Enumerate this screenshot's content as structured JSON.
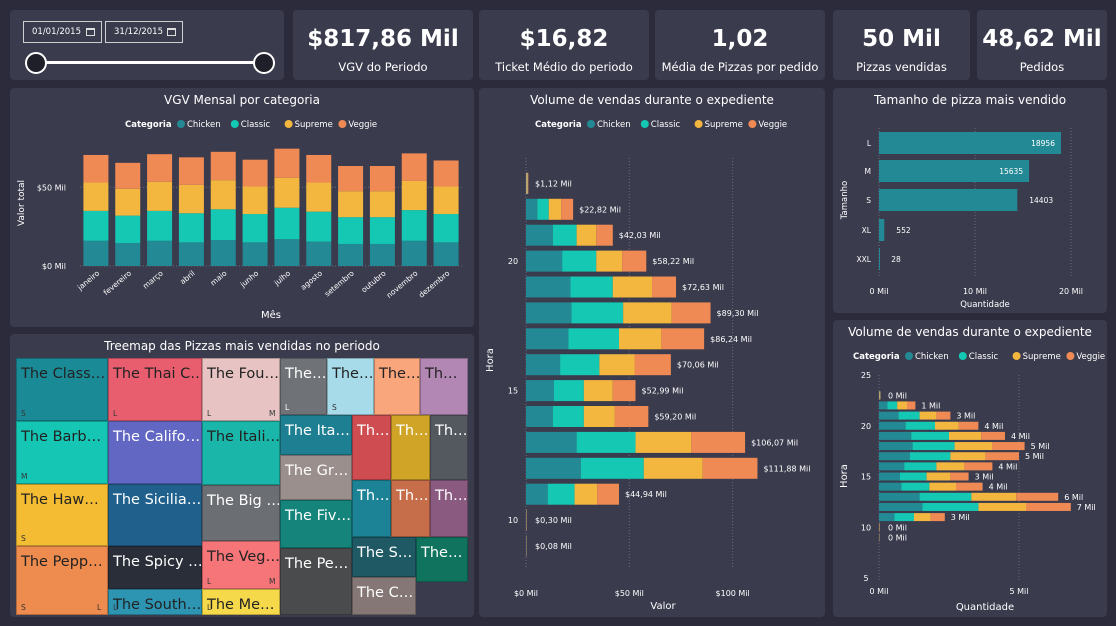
{
  "colors": {
    "chicken": "#238a95",
    "classic": "#14c8b4",
    "supreme": "#f3b63f",
    "veggie": "#ef8a55",
    "bg": "#2b2b3b",
    "panel": "#3a3b4d",
    "size_bar": "#238a95"
  },
  "filter": {
    "start_date": "01/01/2015",
    "end_date": "31/12/2015"
  },
  "kpis": [
    {
      "value": "$817,86 Mil",
      "label": "VGV do Periodo"
    },
    {
      "value": "$16,82",
      "label": "Ticket Médio do periodo"
    },
    {
      "value": "1,02",
      "label": "Média de Pizzas por pedido"
    },
    {
      "value": "50 Mil",
      "label": "Pizzas vendidas"
    },
    {
      "value": "48,62 Mil",
      "label": "Pedidos"
    }
  ],
  "legend": {
    "title": "Categoria",
    "items": [
      "Chicken",
      "Classic",
      "Supreme",
      "Veggie"
    ]
  },
  "chart_data": [
    {
      "type": "bar",
      "stacked": true,
      "title": "VGV Mensal por categoria",
      "xlabel": "Mês",
      "ylabel": "Valor total",
      "categories": [
        "janeiro",
        "fevereiro",
        "março",
        "abril",
        "maio",
        "junho",
        "julho",
        "agosto",
        "setembro",
        "outubro",
        "novembro",
        "dezembro"
      ],
      "series": [
        {
          "name": "Chicken",
          "values": [
            16,
            14.5,
            16,
            15,
            16.5,
            15,
            17,
            15.5,
            14,
            14,
            16,
            15
          ]
        },
        {
          "name": "Classic",
          "values": [
            19,
            17.5,
            19,
            18.5,
            19.5,
            18,
            20,
            19,
            17,
            17,
            19.5,
            18
          ]
        },
        {
          "name": "Supreme",
          "values": [
            18,
            17,
            18.5,
            18,
            18.5,
            17.5,
            19,
            18.5,
            16.5,
            16.5,
            18.5,
            17.5
          ]
        },
        {
          "name": "Veggie",
          "values": [
            17.5,
            16.5,
            17.5,
            17.5,
            18,
            17,
            18.5,
            17.5,
            16,
            16,
            17.5,
            16.5
          ]
        }
      ],
      "yticks": [
        "$0 Mil",
        "$50 Mil"
      ],
      "ylim": [
        0,
        80
      ]
    },
    {
      "type": "bar",
      "orientation": "horizontal",
      "stacked": true,
      "title": "Volume de vendas durante o expediente",
      "xlabel": "Valor",
      "ylabel": "Hora",
      "categories": [
        9,
        10,
        11,
        12,
        13,
        14,
        15,
        16,
        17,
        18,
        19,
        20,
        21,
        22,
        23
      ],
      "series": [
        {
          "name": "Chicken",
          "values": [
            0.02,
            0.07,
            10.5,
            26.5,
            24.5,
            13.0,
            13.5,
            16.5,
            20.5,
            22.0,
            21.5,
            17.5,
            13.0,
            5.5,
            0.3
          ]
        },
        {
          "name": "Classic",
          "values": [
            0.02,
            0.08,
            13.0,
            30.5,
            28.5,
            15.0,
            14.5,
            19.0,
            24.5,
            25.0,
            20.5,
            16.5,
            11.5,
            5.5,
            0.3
          ]
        },
        {
          "name": "Supreme",
          "values": [
            0.02,
            0.08,
            11.0,
            28.5,
            27.0,
            15.0,
            14.0,
            17.0,
            20.5,
            23.5,
            19.0,
            12.5,
            9.5,
            6.0,
            0.3
          ]
        },
        {
          "name": "Veggie",
          "values": [
            0.02,
            0.07,
            10.5,
            26.5,
            26.0,
            16.2,
            11.0,
            17.6,
            20.7,
            18.8,
            11.6,
            11.7,
            8.0,
            5.8,
            0.22
          ]
        }
      ],
      "data_labels": [
        "$0,08 Mil",
        "$0,30 Mil",
        "$44,94 Mil",
        "$111,88 Mil",
        "$106,07 Mil",
        "$59,20 Mil",
        "$52,99 Mil",
        "$70,06 Mil",
        "$86,24 Mil",
        "$89,30 Mil",
        "$72,63 Mil",
        "$58,22 Mil",
        "$42,03 Mil",
        "$22,82 Mil",
        "$1,12 Mil"
      ],
      "xticks": [
        "$0 Mil",
        "$50 Mil",
        "$100 Mil"
      ],
      "yticks": [
        "10",
        "15",
        "20"
      ],
      "xlim": [
        0,
        120
      ]
    },
    {
      "type": "bar",
      "orientation": "horizontal",
      "title": "Tamanho de pizza mais vendido",
      "xlabel": "Quantidade",
      "ylabel": "Tamanho",
      "categories": [
        "L",
        "M",
        "S",
        "XL",
        "XXL"
      ],
      "values": [
        18956,
        15635,
        14403,
        552,
        28
      ],
      "xticks": [
        "0 Mil",
        "10 Mil",
        "20 Mil"
      ],
      "xlim": [
        0,
        20000
      ]
    },
    {
      "type": "bar",
      "orientation": "horizontal",
      "stacked": true,
      "title": "Volume de vendas durante o expediente",
      "xlabel": "Quantidade",
      "ylabel": "Hora",
      "categories": [
        9,
        10,
        11,
        12,
        13,
        14,
        15,
        16,
        17,
        18,
        19,
        20,
        21,
        22,
        23
      ],
      "series": [
        {
          "name": "Chicken",
          "values": [
            0.002,
            0.006,
            0.55,
            1.55,
            1.45,
            0.8,
            0.75,
            0.9,
            1.1,
            1.2,
            1.15,
            0.95,
            0.7,
            0.3,
            0.01
          ]
        },
        {
          "name": "Classic",
          "values": [
            0.002,
            0.007,
            0.7,
            2.0,
            1.85,
            1.0,
            0.95,
            1.15,
            1.45,
            1.5,
            1.35,
            1.05,
            0.75,
            0.35,
            0.012
          ]
        },
        {
          "name": "Supreme",
          "values": [
            0.002,
            0.006,
            0.6,
            1.7,
            1.6,
            0.95,
            0.85,
            1.0,
            1.25,
            1.35,
            1.15,
            0.85,
            0.6,
            0.35,
            0.01
          ]
        },
        {
          "name": "Veggie",
          "values": [
            0.002,
            0.005,
            0.5,
            1.6,
            1.5,
            0.95,
            0.65,
            1.0,
            1.2,
            1.15,
            0.85,
            0.7,
            0.5,
            0.3,
            0.008
          ]
        }
      ],
      "data_labels": [
        "0 Mil",
        "0 Mil",
        "3 Mil",
        "7 Mil",
        "6 Mil",
        "4 Mil",
        "3 Mil",
        "4 Mil",
        "5 Mil",
        "5 Mil",
        "4 Mil",
        "4 Mil",
        "3 Mil",
        "1 Mil",
        "0 Mil"
      ],
      "xticks": [
        "0 Mil",
        "5 Mil"
      ],
      "yticks": [
        "5",
        "10",
        "15",
        "20",
        "25"
      ],
      "ylim": [
        5,
        25
      ],
      "xlim": [
        0,
        8
      ]
    },
    {
      "type": "treemap",
      "title": "Treemap das Pizzas mais vendidas no periodo",
      "cells": [
        {
          "name": "The Class…",
          "color": "#1b8a97",
          "sizes": [
            "S"
          ]
        },
        {
          "name": "The Thai C…",
          "color": "#e85e6f",
          "sizes": [
            "L"
          ]
        },
        {
          "name": "The Fou…",
          "color": "#e7c4c3",
          "sizes": [
            "L",
            "M"
          ]
        },
        {
          "name": "The…",
          "color": "#6f7378",
          "sizes": [
            "L"
          ]
        },
        {
          "name": "The…",
          "color": "#a7dbea",
          "sizes": [
            "S"
          ]
        },
        {
          "name": "The…",
          "color": "#f9a67d",
          "sizes": []
        },
        {
          "name": "Th…",
          "color": "#b287b3",
          "sizes": []
        },
        {
          "name": "The Barb…",
          "color": "#16c6b5",
          "sizes": [
            "M"
          ]
        },
        {
          "name": "The Califo…",
          "color": "#6367c4",
          "sizes": []
        },
        {
          "name": "The Itali…",
          "color": "#19b6a9",
          "sizes": []
        },
        {
          "name": "The Ita…",
          "color": "#1e7f92",
          "sizes": []
        },
        {
          "name": "Th…",
          "color": "#cf4d51",
          "sizes": []
        },
        {
          "name": "Th…",
          "color": "#cfa427",
          "sizes": []
        },
        {
          "name": "Th…",
          "color": "#545960",
          "sizes": []
        },
        {
          "name": "The Haw…",
          "color": "#f3bc32",
          "sizes": [
            "S"
          ]
        },
        {
          "name": "The Sicilia…",
          "color": "#1f608c",
          "sizes": []
        },
        {
          "name": "The Big …",
          "color": "#6b6e73",
          "sizes": []
        },
        {
          "name": "The Gr…",
          "color": "#9a8f8c",
          "sizes": []
        },
        {
          "name": "Th…",
          "color": "#1c8396",
          "sizes": []
        },
        {
          "name": "Th…",
          "color": "#c66d49",
          "sizes": []
        },
        {
          "name": "Th…",
          "color": "#8b5a80",
          "sizes": []
        },
        {
          "name": "The Spicy …",
          "color": "#2a2e38",
          "sizes": []
        },
        {
          "name": "The Veg…",
          "color": "#f57579",
          "sizes": [
            "L",
            "M"
          ]
        },
        {
          "name": "The Fiv…",
          "color": "#15857c",
          "sizes": []
        },
        {
          "name": "The Pepp…",
          "color": "#ee8c4f",
          "sizes": [
            "S",
            "L"
          ]
        },
        {
          "name": "The South…",
          "color": "#2d94b2",
          "sizes": [
            "L"
          ]
        },
        {
          "name": "The Me…",
          "color": "#f6d94b",
          "sizes": [
            "L"
          ]
        },
        {
          "name": "The Pe…",
          "color": "#4a4b4c",
          "sizes": []
        },
        {
          "name": "The S…",
          "color": "#1e5964",
          "sizes": []
        },
        {
          "name": "The…",
          "color": "#10735e",
          "sizes": []
        },
        {
          "name": "The C…",
          "color": "#857775",
          "sizes": []
        }
      ]
    }
  ]
}
